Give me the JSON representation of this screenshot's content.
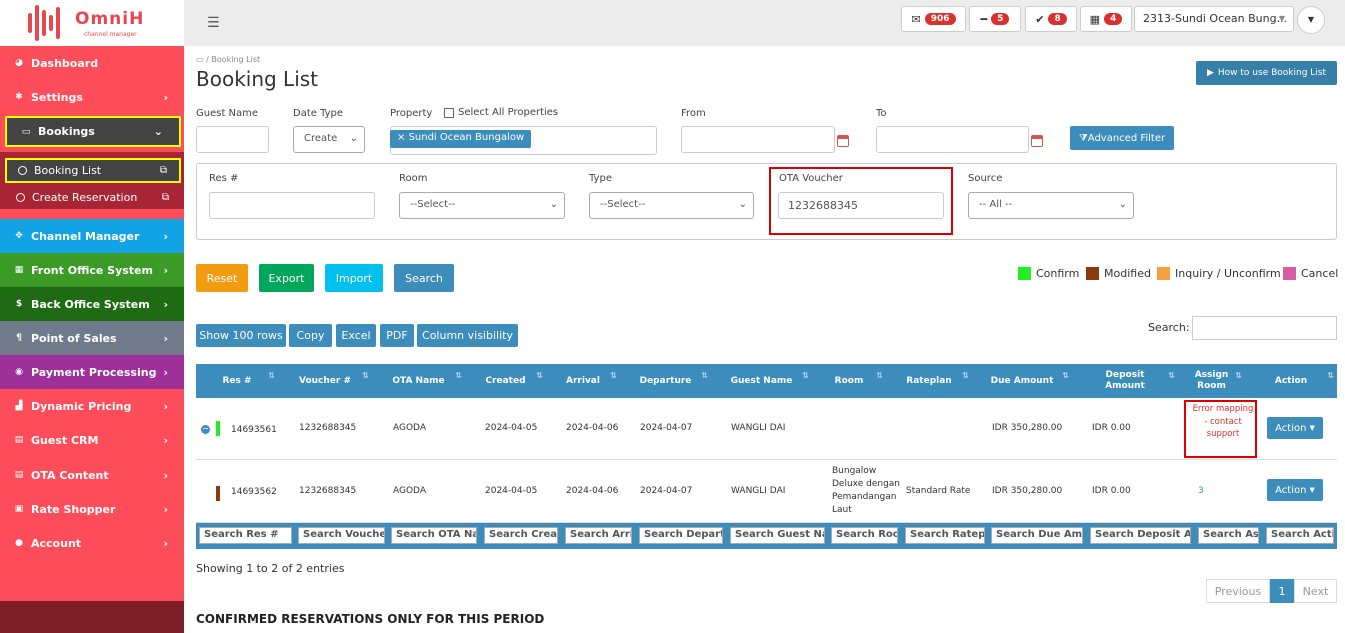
{
  "brand": {
    "name": "OmniH",
    "sub": "channel manager"
  },
  "topbar": {
    "mail_count": "906",
    "minus_count": "5",
    "check_count": "8",
    "calendar_count": "4",
    "property": "2313-Sundi Ocean Bung..."
  },
  "sidebar": {
    "items": [
      {
        "label": "Dashboard",
        "icon": "dashboard-icon"
      },
      {
        "label": "Settings",
        "icon": "gear-icon"
      },
      {
        "label": "Bookings",
        "icon": "keyboard-icon"
      },
      {
        "label": "Channel Manager",
        "icon": "arrows-icon"
      },
      {
        "label": "Front Office System",
        "icon": "calendar-icon"
      },
      {
        "label": "Back Office System",
        "icon": "dollar-icon"
      },
      {
        "label": "Point of Sales",
        "icon": "cutlery-icon"
      },
      {
        "label": "Payment Processing",
        "icon": "circle-icon"
      },
      {
        "label": "Dynamic Pricing",
        "icon": "chart-icon"
      },
      {
        "label": "Guest CRM",
        "icon": "file-icon"
      },
      {
        "label": "OTA Content",
        "icon": "file-icon"
      },
      {
        "label": "Rate Shopper",
        "icon": "briefcase-icon"
      },
      {
        "label": "Account",
        "icon": "user-icon"
      }
    ],
    "sub_items": [
      {
        "label": "Booking List"
      },
      {
        "label": "Create Reservation"
      }
    ]
  },
  "page": {
    "breadcrumb": "Booking List",
    "title": "Booking List",
    "howto": "How to use Booking List"
  },
  "filters": {
    "guest_name_label": "Guest Name",
    "date_type_label": "Date Type",
    "date_type_value": "Create",
    "property_label": "Property",
    "select_all": "Select All Properties",
    "property_tag": "Sundi Ocean Bungalow",
    "from_label": "From",
    "to_label": "To",
    "advanced": "Advanced Filter",
    "res_label": "Res #",
    "room_label": "Room",
    "room_value": "--Select--",
    "type_label": "Type",
    "type_value": "--Select--",
    "ota_label": "OTA Voucher",
    "ota_value": "1232688345",
    "source_label": "Source",
    "source_value": "-- All --"
  },
  "actions": {
    "reset": "Reset",
    "export": "Export",
    "import": "Import",
    "search": "Search"
  },
  "legend": [
    {
      "label": "Confirm",
      "color": "#22ee22"
    },
    {
      "label": "Modified",
      "color": "#8b3a0e"
    },
    {
      "label": "Inquiry / Unconfirm",
      "color": "#f7a040"
    },
    {
      "label": "Cancel",
      "color": "#d95aa7"
    }
  ],
  "table_tools": {
    "rows": "Show 100 rows",
    "copy": "Copy",
    "excel": "Excel",
    "pdf": "PDF",
    "colvis": "Column visibility",
    "search_label": "Search:"
  },
  "table": {
    "headers": [
      "Res #",
      "Voucher #",
      "OTA Name",
      "Created",
      "Arrival",
      "Departure",
      "Guest Name",
      "Room",
      "Rateplan",
      "Due Amount",
      "Deposit Amount",
      "Assign Room",
      "Action"
    ],
    "rows": [
      {
        "res": "14693561",
        "voucher": "1232688345",
        "ota": "AGODA",
        "created": "2024-04-05",
        "arrival": "2024-04-06",
        "departure": "2024-04-07",
        "guest": "WANGLI DAI",
        "room": "",
        "rateplan": "",
        "due": "IDR 350,280.00",
        "deposit": "IDR 0.00",
        "assign": "Error mapping - contact support",
        "action": "Action",
        "status_color": "#22ee22"
      },
      {
        "res": "14693562",
        "voucher": "1232688345",
        "ota": "AGODA",
        "created": "2024-04-05",
        "arrival": "2024-04-06",
        "departure": "2024-04-07",
        "guest": "WANGLI DAI",
        "room": "Bungalow Deluxe dengan Pemandangan Laut",
        "rateplan": "Standard Rate",
        "due": "IDR 350,280.00",
        "deposit": "IDR 0.00",
        "assign": "3",
        "action": "Action",
        "status_color": "#8b3a0e"
      }
    ],
    "footer_search": [
      "Search Res #",
      "Search Voucher",
      "Search OTA Nar",
      "Search Creat",
      "Search Arriv",
      "Search Departu",
      "Search Guest Nai",
      "Search Roor",
      "Search Rateplı",
      "Search Due Amo",
      "Search Deposit An",
      "Search Ass",
      "Search Actio"
    ]
  },
  "showing": "Showing 1 to 2 of 2 entries",
  "pager": {
    "prev": "Previous",
    "page": "1",
    "next": "Next"
  },
  "confirmed_heading": "CONFIRMED RESERVATIONS ONLY FOR THIS PERIOD"
}
